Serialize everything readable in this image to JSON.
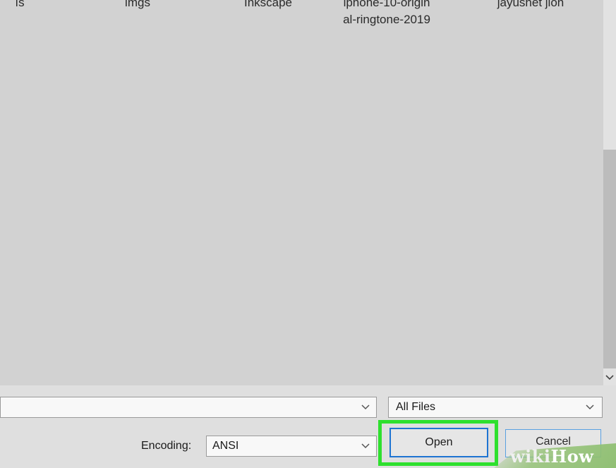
{
  "files": [
    {
      "line1": "ıs",
      "line2": ""
    },
    {
      "line1": "imgs",
      "line2": ""
    },
    {
      "line1": "Inkscape",
      "line2": ""
    },
    {
      "line1": "iphone-10-origin",
      "line2": "al-ringtone-2019"
    },
    {
      "line1": "jayushet jion",
      "line2": ""
    }
  ],
  "filename": {
    "value": "",
    "placeholder": ""
  },
  "file_type": {
    "selected": "All Files"
  },
  "encoding": {
    "label": "Encoding:",
    "selected": "ANSI"
  },
  "buttons": {
    "open": "Open",
    "cancel": "Cancel"
  },
  "watermark": {
    "prefix": "wiki",
    "suffix": "How"
  },
  "colors": {
    "highlight": "#2ee02e",
    "focus_border": "#1e74d2",
    "watermark": "#8cbe6e"
  },
  "icons": {
    "dropdown": "chevron-down-icon",
    "scroll_down": "chevron-down-icon"
  }
}
